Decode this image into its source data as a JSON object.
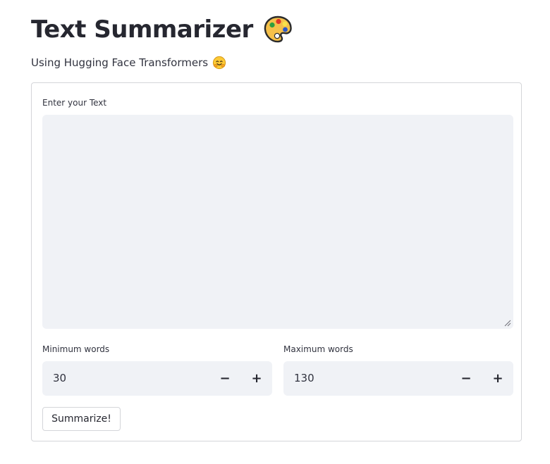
{
  "header": {
    "title": "Text Summarizer",
    "title_icon": "artist-palette-icon",
    "subtitle": "Using Hugging Face Transformers",
    "subtitle_icon": "hugging-face-icon"
  },
  "form": {
    "text_label": "Enter your Text",
    "text_value": "",
    "min_words": {
      "label": "Minimum words",
      "value": "30",
      "decrement": "−",
      "increment": "+"
    },
    "max_words": {
      "label": "Maximum words",
      "value": "130",
      "decrement": "−",
      "increment": "+"
    },
    "submit_label": "Summarize!"
  },
  "colors": {
    "input_background": "#f0f2f6",
    "border": "#d4d5d9",
    "text": "#31333f",
    "heading": "#262730"
  }
}
